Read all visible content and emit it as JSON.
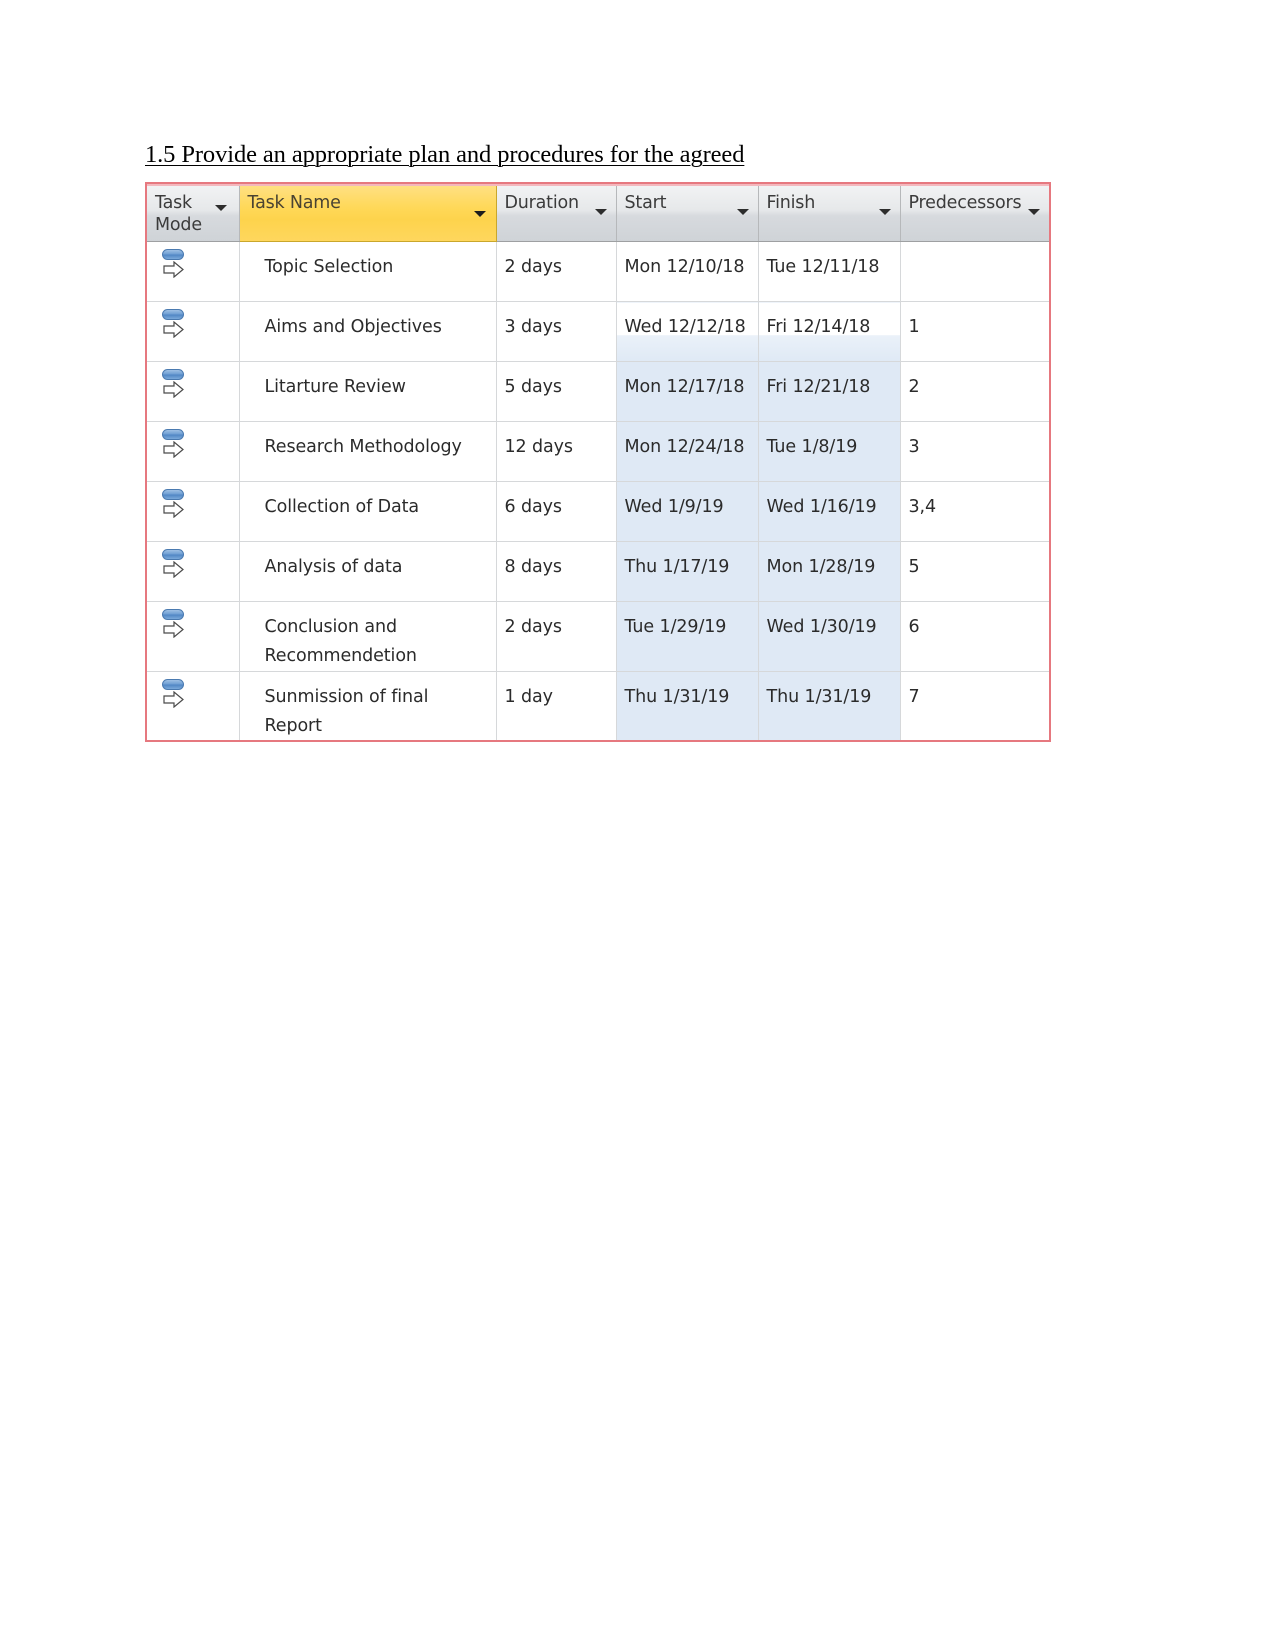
{
  "document": {
    "heading": "1.5 Provide an appropriate plan and procedures for the agreed"
  },
  "colors": {
    "screenshot_border": "#e6787f",
    "task_name_header": "#ffd858",
    "header_gray": "#e6e8ea",
    "date_highlight": "#dfe9f5",
    "grid_line": "#d6d8da"
  },
  "table": {
    "columns": [
      {
        "key": "task_mode",
        "label": "Task\nMode",
        "has_filter": true,
        "icon": "chevron-down-icon"
      },
      {
        "key": "task_name",
        "label": "Task Name",
        "has_filter": true,
        "icon": "chevron-down-icon",
        "highlighted": true
      },
      {
        "key": "duration",
        "label": "Duration",
        "has_filter": true,
        "icon": "chevron-down-icon"
      },
      {
        "key": "start",
        "label": "Start",
        "has_filter": true,
        "icon": "chevron-down-icon"
      },
      {
        "key": "finish",
        "label": "Finish",
        "has_filter": true,
        "icon": "chevron-down-icon"
      },
      {
        "key": "predecessors",
        "label": "Predecessors",
        "has_filter": true,
        "icon": "chevron-down-icon"
      }
    ],
    "header": {
      "task_mode_line1": "Task",
      "task_mode_line2": "Mode",
      "task_name": "Task Name",
      "duration": "Duration",
      "start": "Start",
      "finish": "Finish",
      "predecessors": "Predecessors"
    },
    "rows": [
      {
        "task_mode_icon": "auto-scheduled-icon",
        "task_name": "Topic Selection",
        "duration": "2 days",
        "start": "Mon 12/10/18",
        "finish": "Tue 12/11/18",
        "predecessors": ""
      },
      {
        "task_mode_icon": "auto-scheduled-icon",
        "task_name": "Aims and Objectives",
        "duration": "3 days",
        "start": "Wed 12/12/18",
        "finish": "Fri 12/14/18",
        "predecessors": "1"
      },
      {
        "task_mode_icon": "auto-scheduled-icon",
        "task_name": "Litarture Review",
        "duration": "5 days",
        "start": "Mon 12/17/18",
        "finish": "Fri 12/21/18",
        "predecessors": "2"
      },
      {
        "task_mode_icon": "auto-scheduled-icon",
        "task_name": "Research Methodology",
        "duration": "12 days",
        "start": "Mon 12/24/18",
        "finish": "Tue 1/8/19",
        "predecessors": "3"
      },
      {
        "task_mode_icon": "auto-scheduled-icon",
        "task_name": "Collection of Data",
        "duration": "6 days",
        "start": "Wed 1/9/19",
        "finish": "Wed 1/16/19",
        "predecessors": "3,4"
      },
      {
        "task_mode_icon": "auto-scheduled-icon",
        "task_name": "Analysis of data",
        "duration": "8 days",
        "start": "Thu 1/17/19",
        "finish": "Mon 1/28/19",
        "predecessors": "5"
      },
      {
        "task_mode_icon": "auto-scheduled-icon",
        "task_name": "Conclusion and Recommendetion",
        "duration": "2 days",
        "start": "Tue 1/29/19",
        "finish": "Wed 1/30/19",
        "predecessors": "6"
      },
      {
        "task_mode_icon": "auto-scheduled-icon",
        "task_name": "Sunmission of final Report",
        "duration": "1 day",
        "start": "Thu 1/31/19",
        "finish": "Thu 1/31/19",
        "predecessors": "7"
      }
    ]
  }
}
